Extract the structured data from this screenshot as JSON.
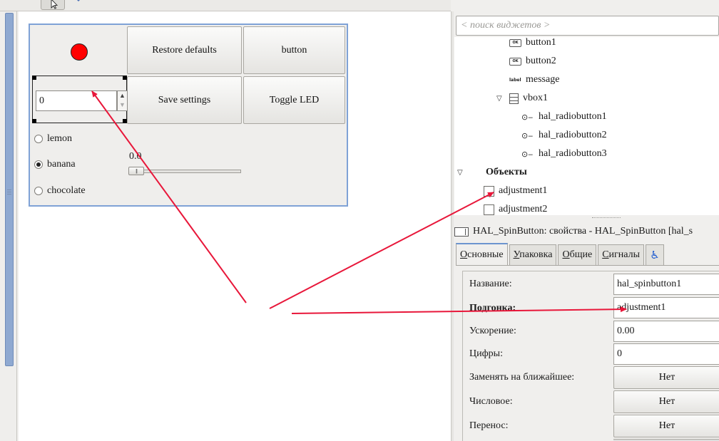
{
  "colors": {
    "led_on": "#ff0000",
    "selection_border": "#7fa2d6",
    "annotation_arrow": "#e8173a",
    "tab_active_accent": "#6c95cf"
  },
  "toolbar": {
    "icons": [
      "toolbar-icon",
      "pointer-icon",
      "drag-resize-icon"
    ]
  },
  "designer": {
    "buttons": {
      "restore_defaults": "Restore defaults",
      "button": "button",
      "save_settings": "Save settings",
      "toggle_led": "Toggle LED"
    },
    "spin_value": "0",
    "radios": [
      {
        "label": "lemon",
        "selected": false
      },
      {
        "label": "banana",
        "selected": true
      },
      {
        "label": "chocolate",
        "selected": false
      }
    ],
    "slider_value": "0.0",
    "slider_fraction": 0
  },
  "widget_tree": {
    "search_placeholder": "< поиск виджетов >",
    "rows": [
      {
        "label": "button1",
        "icon": "ok-button-icon"
      },
      {
        "label": "button2",
        "icon": "ok-button-icon"
      },
      {
        "label": "message",
        "icon": "label-icon"
      },
      {
        "label": "vbox1",
        "icon": "vbox-icon",
        "expanded": true
      },
      {
        "label": "hal_radiobutton1",
        "icon": "radio-button-icon"
      },
      {
        "label": "hal_radiobutton2",
        "icon": "radio-button-icon"
      },
      {
        "label": "hal_radiobutton3",
        "icon": "radio-button-icon"
      }
    ],
    "objects_header": "Объекты",
    "objects": [
      {
        "label": "adjustment1"
      },
      {
        "label": "adjustment2"
      }
    ],
    "icon_texts": {
      "ok": "OK",
      "label": "label"
    }
  },
  "properties": {
    "title": "HAL_SpinButton: свойства - HAL_SpinButton [hal_s",
    "tabs": [
      {
        "label": "Основные",
        "mnemonic": "О",
        "rest": "сновные",
        "active": true
      },
      {
        "label": "Упаковка",
        "mnemonic": "У",
        "rest": "паковка",
        "active": false
      },
      {
        "label": "Общие",
        "mnemonic": "О",
        "rest": "бщие",
        "active": false
      },
      {
        "label": "Сигналы",
        "mnemonic": "С",
        "rest": "игналы",
        "active": false
      }
    ],
    "rows": [
      {
        "label": "Название:",
        "value": "hal_spinbutton1",
        "kind": "entry",
        "bold": false
      },
      {
        "label": "Подгонка:",
        "value": "adjustment1",
        "kind": "entry",
        "bold": true
      },
      {
        "label": "Ускорение:",
        "value": "0.00",
        "kind": "entry",
        "bold": false
      },
      {
        "label": "Цифры:",
        "value": "0",
        "kind": "entry",
        "bold": false
      },
      {
        "label": "Заменять на ближайшее:",
        "value": "Нет",
        "kind": "button",
        "bold": false
      },
      {
        "label": "Числовое:",
        "value": "Нет",
        "kind": "button",
        "bold": false
      },
      {
        "label": "Перенос:",
        "value": "Нет",
        "kind": "button",
        "bold": false
      }
    ]
  }
}
